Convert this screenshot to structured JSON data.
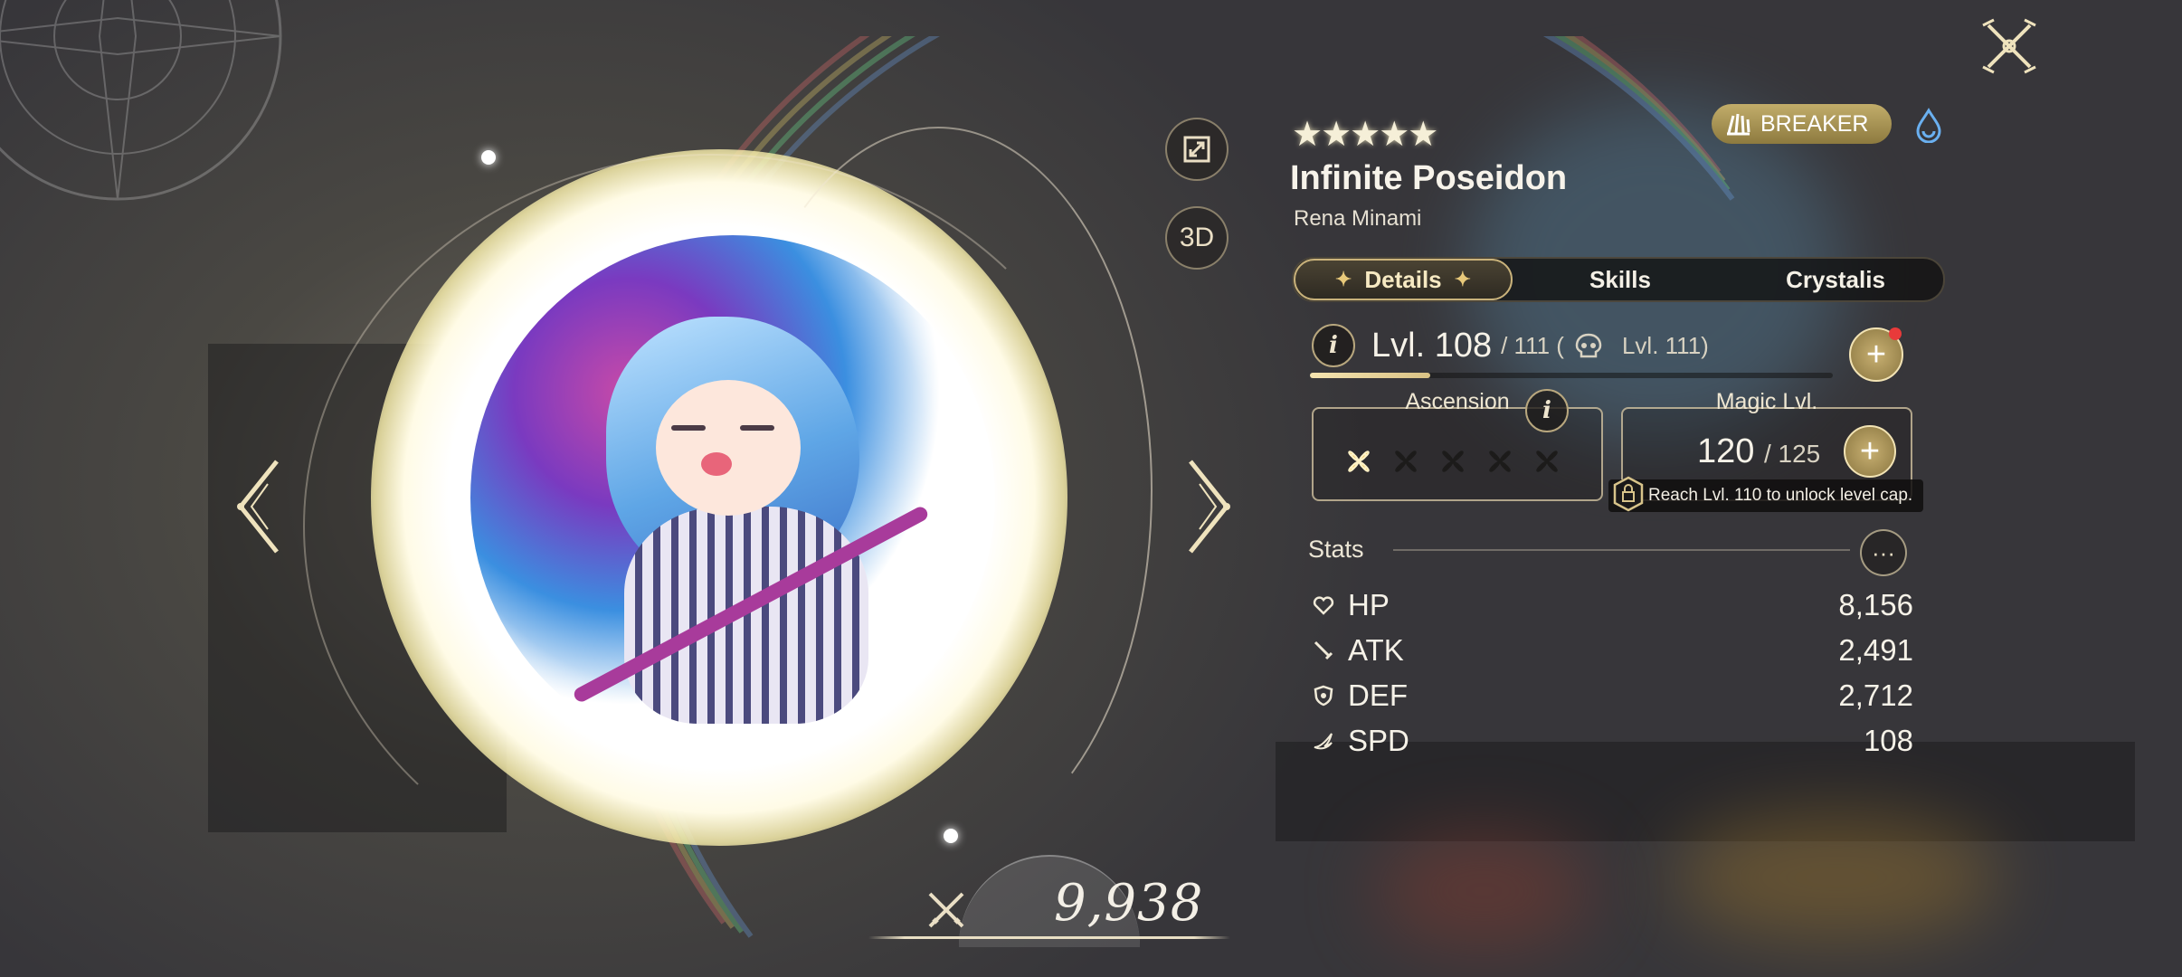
{
  "colors": {
    "accent_gold": "#c9b27b",
    "badge_gold": "#a8924f",
    "notification_red": "#e83a3a",
    "element_blue": "#6ab0f0"
  },
  "character": {
    "rarity_stars": "★★★★★",
    "class_label": "BREAKER",
    "class_icon": "breaker-claw-icon",
    "element_icon": "water-element-icon",
    "name": "Infinite Poseidon",
    "subtitle": "Rena Minami"
  },
  "side_buttons": {
    "expand_icon": "expand-icon",
    "three_d_label": "3D"
  },
  "power": {
    "value": "9,938",
    "icon": "crossed-swords-icon"
  },
  "tabs": [
    {
      "label": "Details",
      "active": true
    },
    {
      "label": "Skills",
      "active": false
    },
    {
      "label": "Crystalis",
      "active": false
    }
  ],
  "level": {
    "info_label": "i",
    "current": "Lvl. 108",
    "cap": "/ 111 (",
    "max_label": "Lvl. 111)",
    "progress": 0.23
  },
  "ascension": {
    "title": "Ascension",
    "info_label": "i",
    "filled": 1,
    "total": 5
  },
  "magic": {
    "title": "Magic Lvl.",
    "current": "120",
    "cap": "/ 125",
    "tooltip": "Reach Lvl. 110 to unlock level cap."
  },
  "stats": {
    "title": "Stats",
    "more_label": "···",
    "items": [
      {
        "name": "HP",
        "value": "8,156",
        "icon": "heart-icon"
      },
      {
        "name": "ATK",
        "value": "2,491",
        "icon": "sword-icon"
      },
      {
        "name": "DEF",
        "value": "2,712",
        "icon": "shield-icon"
      },
      {
        "name": "SPD",
        "value": "108",
        "icon": "wing-icon"
      }
    ]
  }
}
